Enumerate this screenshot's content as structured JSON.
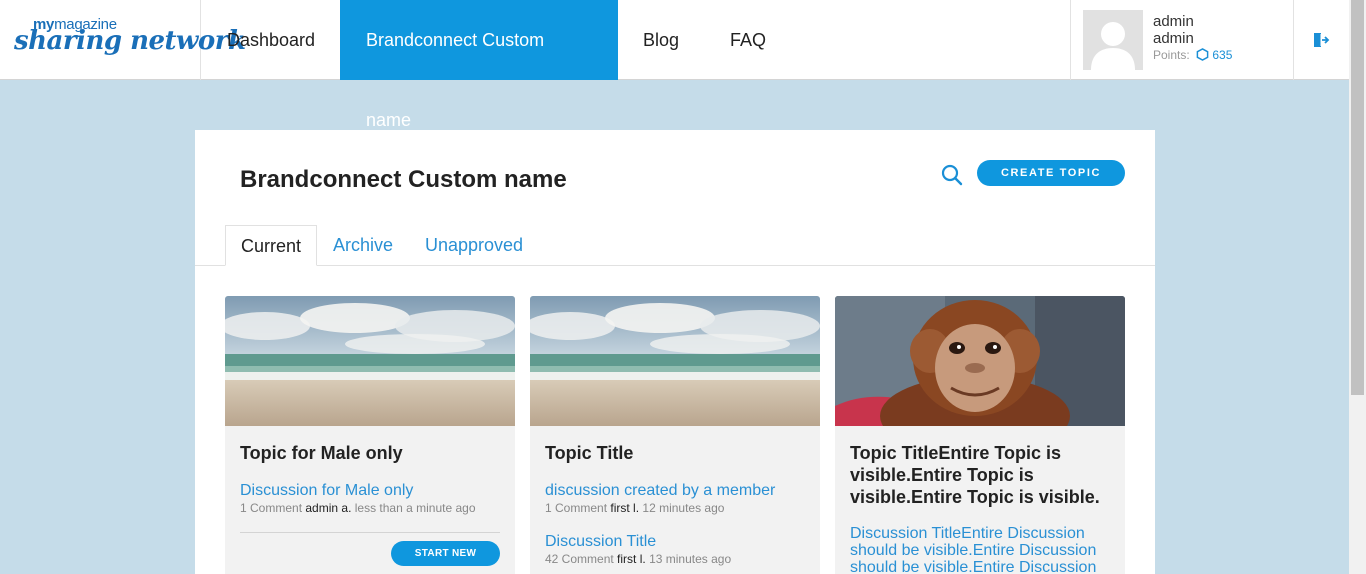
{
  "brand": {
    "top_prefix": "my",
    "top_word": "magazine",
    "bottom": "sharing network"
  },
  "nav": {
    "items": [
      {
        "label": "Dashboard"
      },
      {
        "label": "Brandconnect Custom name"
      },
      {
        "label": "Blog"
      },
      {
        "label": "FAQ"
      }
    ],
    "active_index": 1
  },
  "user": {
    "name": "admin",
    "role": "admin",
    "points_label": "Points:",
    "points_value": "635"
  },
  "page": {
    "title": "Brandconnect Custom name",
    "create_label": "CREATE TOPIC",
    "tabs": [
      {
        "label": "Current"
      },
      {
        "label": "Archive"
      },
      {
        "label": "Unapproved"
      }
    ],
    "active_tab": 0
  },
  "cards": [
    {
      "image": "beach-photo",
      "title": "Topic for Male only",
      "discussions": [
        {
          "title": "Discussion for Male only",
          "comments": "1 Comment",
          "author": "admin a.",
          "time": "less than a minute ago"
        }
      ],
      "start_label": "START NEW"
    },
    {
      "image": "beach-photo",
      "title": "Topic Title",
      "discussions": [
        {
          "title": "discussion created by a member",
          "comments": "1 Comment",
          "author": "first l.",
          "time": "12 minutes ago"
        },
        {
          "title": "Discussion Title",
          "comments": "42 Comment",
          "author": "first l.",
          "time": "13 minutes ago"
        }
      ]
    },
    {
      "image": "orangutan-photo",
      "title": "Topic TitleEntire Topic is visible.Entire Topic is visible.Entire Topic is visible.",
      "discussions": [
        {
          "title": "Discussion TitleEntire Discussion should be visible.Entire Discussion should be visible.Entire Discussion"
        }
      ]
    }
  ],
  "colors": {
    "accent": "#0f97de",
    "link": "#2a90d4",
    "page_bg": "#c5dce9",
    "card_bg": "#f2f2f2"
  }
}
